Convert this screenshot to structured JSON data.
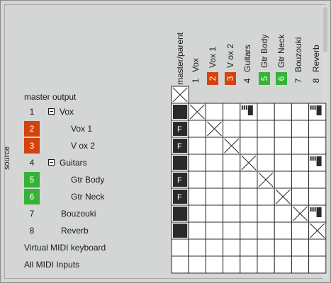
{
  "window": {
    "source_label": "source",
    "master_output_label": "master output",
    "virtual_midi_label": "Virtual MIDI keyboard",
    "all_midi_label": "All MIDI Inputs"
  },
  "columns": [
    {
      "label": "master/parent",
      "num": ""
    },
    {
      "label": "Vox",
      "num": "1"
    },
    {
      "label": "Vox 1",
      "num": "2",
      "color": "#d4430d"
    },
    {
      "label": "V ox 2",
      "num": "3",
      "color": "#d4430d"
    },
    {
      "label": "Guitars",
      "num": "4"
    },
    {
      "label": "Gtr Body",
      "num": "5",
      "color": "#34b337"
    },
    {
      "label": "Gtr Neck",
      "num": "6",
      "color": "#34b337"
    },
    {
      "label": "Bouzouki",
      "num": "7"
    },
    {
      "label": "Reverb",
      "num": "8"
    }
  ],
  "rows": [
    {
      "num": "1",
      "label": "Vox",
      "folder": true
    },
    {
      "num": "2",
      "label": "Vox 1",
      "color": "#d4430d"
    },
    {
      "num": "3",
      "label": "V ox 2",
      "color": "#d4430d"
    },
    {
      "num": "4",
      "label": "Guitars",
      "folder": true
    },
    {
      "num": "5",
      "label": "Gtr Body",
      "color": "#34b337"
    },
    {
      "num": "6",
      "label": "Gtr Neck",
      "color": "#34b337"
    },
    {
      "num": "7",
      "label": "Bouzouki"
    },
    {
      "num": "8",
      "label": "Reverb"
    }
  ],
  "matrix": {
    "master_row": [
      "x",
      "",
      "",
      "",
      "",
      "",
      "",
      "",
      ""
    ],
    "track_rows": [
      [
        "filled",
        "x",
        "",
        "",
        "meter",
        "",
        "",
        "",
        "meter"
      ],
      [
        "F",
        "",
        "x",
        "",
        "",
        "",
        "",
        "",
        ""
      ],
      [
        "F",
        "",
        "",
        "x",
        "",
        "",
        "",
        "",
        ""
      ],
      [
        "filled",
        "",
        "",
        "",
        "x",
        "",
        "",
        "",
        "meter"
      ],
      [
        "F",
        "",
        "",
        "",
        "",
        "x",
        "",
        "",
        ""
      ],
      [
        "F",
        "",
        "",
        "",
        "",
        "",
        "x",
        "",
        ""
      ],
      [
        "filled",
        "",
        "",
        "",
        "",
        "",
        "",
        "x",
        "meter"
      ],
      [
        "filled",
        "",
        "",
        "",
        "",
        "",
        "",
        "",
        "x"
      ]
    ],
    "midi_rows": [
      [
        "",
        "",
        "",
        "",
        "",
        "",
        "",
        "",
        ""
      ],
      [
        "",
        "",
        "",
        "",
        "",
        "",
        "",
        "",
        ""
      ]
    ],
    "cell_f_label": "F"
  },
  "colors": {
    "background": "#d4d6d6",
    "grid_line": "#2b2b2b",
    "cell_bg": "#ffffff",
    "filled": "#2a2a2a",
    "orange": "#d4430d",
    "green": "#34b337"
  }
}
